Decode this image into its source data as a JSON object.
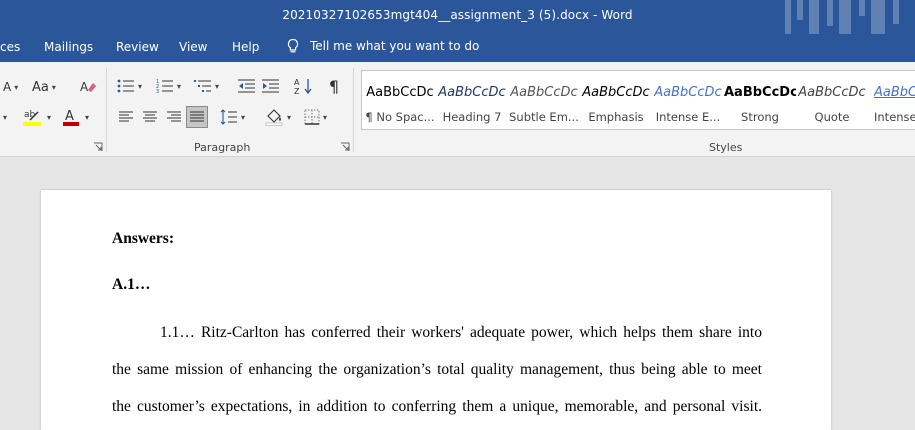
{
  "window": {
    "title": "20210327102653mgt404__assignment_3 (5).docx  -  Word"
  },
  "menu": {
    "items": [
      "ces",
      "Mailings",
      "Review",
      "View",
      "Help"
    ],
    "tell_me": "Tell me what you want to do"
  },
  "ribbon": {
    "paragraph_label": "Paragraph",
    "styles_label": "Styles",
    "font_case": "Aa",
    "font_size_letter": "A",
    "sort_label": "A↓Z",
    "pilcrow": "¶",
    "styles": [
      {
        "sample": "AaBbCcDc",
        "name": "¶ No Spac..."
      },
      {
        "sample": "AaBbCcDc",
        "name": "Heading 7"
      },
      {
        "sample": "AaBbCcDc",
        "name": "Subtle Em..."
      },
      {
        "sample": "AaBbCcDc",
        "name": "Emphasis"
      },
      {
        "sample": "AaBbCcDc",
        "name": "Intense E..."
      },
      {
        "sample": "AaBbCcDc",
        "name": "Strong"
      },
      {
        "sample": "AaBbCcDc",
        "name": "Quote"
      },
      {
        "sample": "AaBbC",
        "name": "Intense"
      }
    ],
    "colors": {
      "highlight": "#ffff00",
      "font_color": "#c00000",
      "accent": "#2b579a"
    }
  },
  "document": {
    "heading1": "Answers:",
    "heading2": "A.1…",
    "lines": [
      "1.1… Ritz-Carlton has conferred their workers' adequate power, which helps them share into",
      "the same mission of enhancing the organization’s total quality management, thus being able to meet",
      "the customer’s expectations, in addition to conferring them a unique, memorable, and personal visit."
    ]
  }
}
